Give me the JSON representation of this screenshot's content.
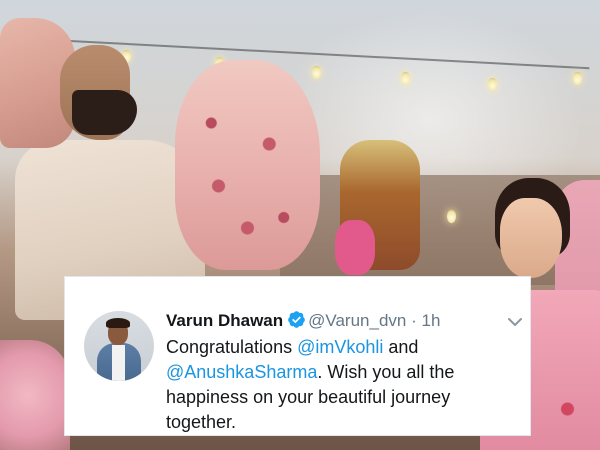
{
  "tweet": {
    "display_name": "Varun Dhawan",
    "handle": "@Varun_dvn",
    "separator": "·",
    "time": "1h",
    "text_part1": "Congratulations ",
    "mention1": "@imVkohli",
    "text_part2": " and ",
    "mention2": "@AnushkaSharma",
    "text_part3": ". Wish you all the happiness on your beautiful journey together.",
    "verified": true
  },
  "colors": {
    "mention": "#1b95e0",
    "handle": "#657786",
    "text": "#14171a",
    "verified_badge": "#1da1f2"
  },
  "icons": {
    "verified": "verified-badge-icon",
    "menu": "chevron-down-icon"
  }
}
